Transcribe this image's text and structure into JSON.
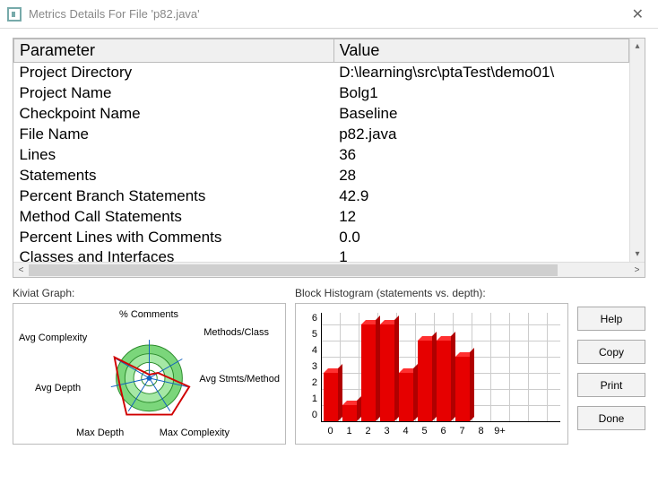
{
  "window": {
    "title": "Metrics Details For File 'p82.java'"
  },
  "table": {
    "headers": {
      "param": "Parameter",
      "value": "Value"
    },
    "rows": [
      {
        "param": "Project Directory",
        "value": "D:\\learning\\src\\ptaTest\\demo01\\"
      },
      {
        "param": "Project Name",
        "value": "Bolg1"
      },
      {
        "param": "Checkpoint Name",
        "value": "Baseline"
      },
      {
        "param": "File Name",
        "value": "p82.java"
      },
      {
        "param": "Lines",
        "value": "36"
      },
      {
        "param": "Statements",
        "value": "28"
      },
      {
        "param": "Percent Branch Statements",
        "value": "42.9"
      },
      {
        "param": "Method Call Statements",
        "value": "12"
      },
      {
        "param": "Percent Lines with Comments",
        "value": "0.0"
      },
      {
        "param": "Classes and Interfaces",
        "value": "1"
      }
    ]
  },
  "kiviat": {
    "title": "Kiviat Graph:",
    "labels": {
      "top": "% Comments",
      "tr": "Methods/Class",
      "r": "Avg Stmts/Method",
      "br": "Max Complexity",
      "bl": "Max Depth",
      "l": "Avg Depth",
      "tl": "Avg Complexity"
    }
  },
  "histogram": {
    "title": "Block Histogram (statements vs. depth):"
  },
  "buttons": {
    "help": "Help",
    "copy": "Copy",
    "print": "Print",
    "done": "Done"
  },
  "chart_data": {
    "type": "bar",
    "categories": [
      "0",
      "1",
      "2",
      "3",
      "4",
      "5",
      "6",
      "7",
      "8",
      "9+"
    ],
    "values": [
      3,
      1,
      6,
      6,
      3,
      5,
      5,
      4,
      0,
      0
    ],
    "xlabel": "depth",
    "ylabel": "statements",
    "ylim": [
      0,
      6
    ],
    "title": "Block Histogram (statements vs. depth)"
  }
}
